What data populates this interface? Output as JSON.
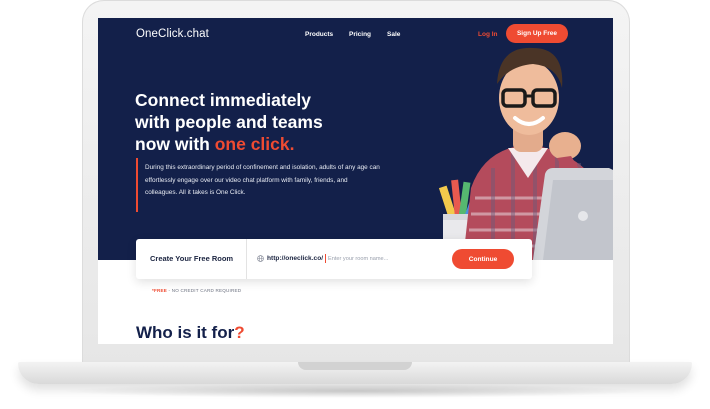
{
  "header": {
    "logo": "OneClick.chat",
    "nav": [
      "Products",
      "Pricing",
      "Sale"
    ],
    "login_label": "Log In",
    "signup_label": "Sign Up Free"
  },
  "hero": {
    "headline_line1": "Connect immediately",
    "headline_line2": "with people and teams",
    "headline_line3_prefix": "now with ",
    "headline_accent": "one click.",
    "lead": "During this extraordinary period of confinement and isolation, adults of any age can effortlessly engage over our video chat platform with family, friends, and colleagues. All it takes is One Click."
  },
  "room_form": {
    "title": "Create Your Free Room",
    "url_prefix": "http://oneclick.co/",
    "input_placeholder": "Enter your room name...",
    "input_value": "",
    "continue_label": "Continue",
    "note_free": "*FREE",
    "note_rest": " - NO CREDIT CARD REQUIRED"
  },
  "section": {
    "title_main": "Who is it for",
    "title_mark": "?"
  },
  "colors": {
    "navy": "#13204a",
    "accent": "#ef4b32"
  }
}
